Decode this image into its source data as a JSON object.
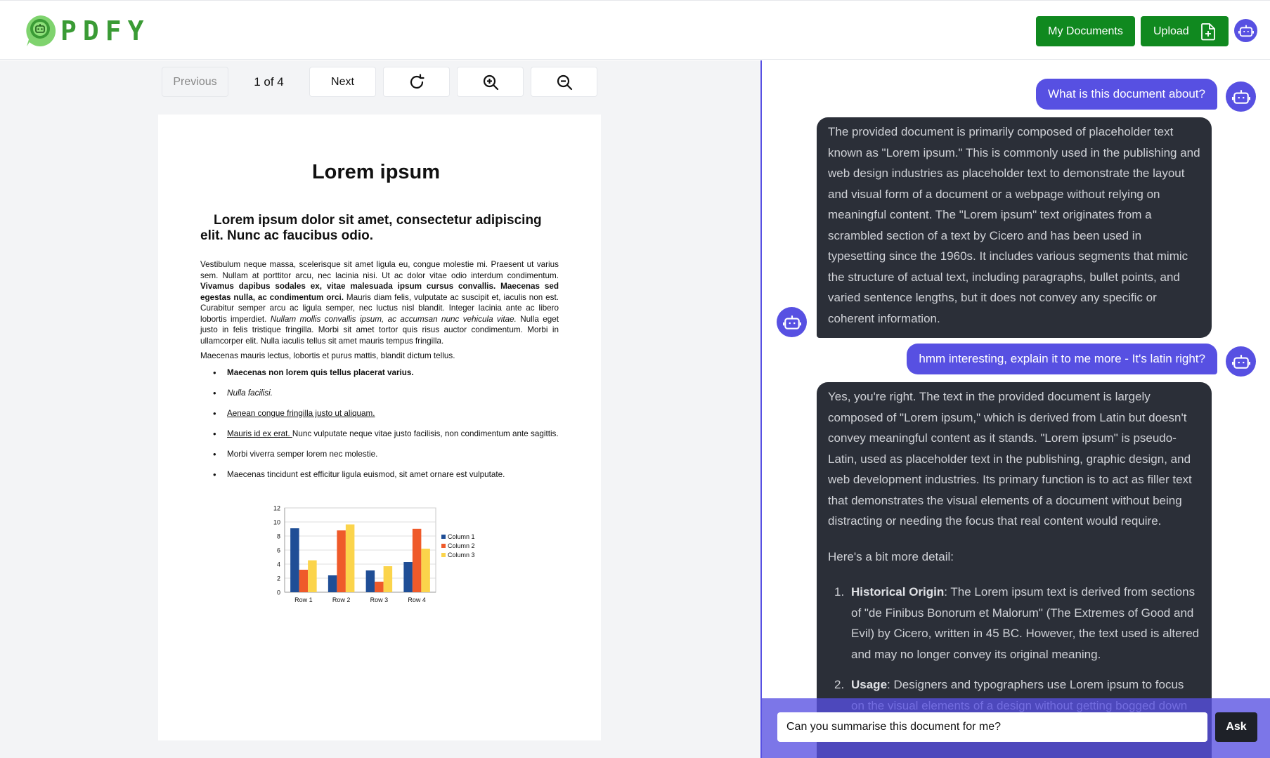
{
  "header": {
    "logo_text": "PDFY",
    "my_documents_label": "My Documents",
    "upload_label": "Upload",
    "icons": {
      "logo": "robot-chat-logo-icon",
      "upload": "file-plus-icon",
      "bot": "robot-icon"
    }
  },
  "toolbar": {
    "previous_label": "Previous",
    "page_indicator": "1 of 4",
    "next_label": "Next",
    "icons": {
      "rotate": "rotate-icon",
      "zoom_in": "zoom-in-icon",
      "zoom_out": "zoom-out-icon"
    }
  },
  "document": {
    "title": "Lorem ipsum",
    "subtitle": "Lorem ipsum dolor sit amet, consectetur adipiscing elit. Nunc ac faucibus odio.",
    "p1": {
      "a": "Vestibulum neque massa, scelerisque sit amet ligula eu, congue molestie mi. Praesent ut varius sem. Nullam at porttitor arcu, nec lacinia nisi. Ut ac dolor vitae odio interdum condimentum. ",
      "b": "Vivamus dapibus sodales ex, vitae malesuada ipsum cursus convallis. Maecenas sed egestas nulla, ac condimentum orci.",
      "c": " Mauris diam felis, vulputate ac suscipit et, iaculis non est. Curabitur semper arcu ac ligula semper, nec luctus nisl blandit. Integer lacinia ante ac libero lobortis imperdiet. ",
      "d": "Nullam mollis convallis ipsum, ac accumsan nunc vehicula vitae.",
      "e": " Nulla eget justo in felis tristique fringilla. Morbi sit amet tortor quis risus auctor condimentum. Morbi in ullamcorper elit. Nulla iaculis tellus sit amet mauris tempus fringilla."
    },
    "p2": "Maecenas mauris lectus, lobortis et purus mattis, blandit dictum tellus.",
    "list": {
      "item1": "Maecenas non lorem quis tellus placerat varius.",
      "item2": "Nulla facilisi.",
      "item3": "Aenean congue fringilla justo ut aliquam. ",
      "item4a": "Mauris id ex erat. ",
      "item4b": "Nunc vulputate neque vitae justo facilisis, non condimentum ante sagittis.",
      "item5": "Morbi viverra semper lorem nec molestie.",
      "item6": "Maecenas tincidunt est efficitur ligula euismod, sit amet ornare est vulputate."
    }
  },
  "chart_data": {
    "type": "bar",
    "categories": [
      "Row 1",
      "Row 2",
      "Row 3",
      "Row 4"
    ],
    "series": [
      {
        "name": "Column 1",
        "values": [
          9.1,
          2.4,
          3.1,
          4.3
        ],
        "color": "#1f4e96"
      },
      {
        "name": "Column 2",
        "values": [
          3.2,
          8.8,
          1.5,
          9.02
        ],
        "color": "#ef5a2a"
      },
      {
        "name": "Column 3",
        "values": [
          4.54,
          9.65,
          3.7,
          6.2
        ],
        "color": "#fbd44b"
      }
    ],
    "ylim": [
      0,
      12
    ],
    "yticks": [
      0,
      2,
      4,
      6,
      8,
      10,
      12
    ],
    "legend": "right",
    "grid": true
  },
  "chat": {
    "user_msg_1": "What is this document about?",
    "assistant_msg_1": "The provided document is primarily composed of placeholder text known as \"Lorem ipsum.\" This is commonly used in the publishing and web design industries as placeholder text to demonstrate the layout and visual form of a document or a webpage without relying on meaningful content. The \"Lorem ipsum\" text originates from a scrambled section of a text by Cicero and has been used in typesetting since the 1960s. It includes various segments that mimic the structure of actual text, including paragraphs, bullet points, and varied sentence lengths, but it does not convey any specific or coherent information.",
    "user_msg_2": "hmm interesting, explain it to me more - It's latin right?",
    "assistant_msg_2": {
      "p1": "Yes, you're right. The text in the provided document is largely composed of \"Lorem ipsum,\" which is derived from Latin but doesn't convey meaningful content as it stands. \"Lorem ipsum\" is pseudo-Latin, used as placeholder text in the publishing, graphic design, and web development industries. Its primary function is to act as filler text that demonstrates the visual elements of a document without being distracting or needing the focus that real content would require.",
      "p2": "Here's a bit more detail:",
      "item1_num": "1.",
      "item1_title": "Historical Origin",
      "item1_text": ": The Lorem ipsum text is derived from sections of \"de Finibus Bonorum et Malorum\" (The Extremes of Good and Evil) by Cicero, written in 45 BC. However, the text used is altered and may no longer convey its original meaning.",
      "item2_num": "2.",
      "item2_title": "Usage",
      "item2_text": ": Designers and typographers use Lorem ipsum to focus on the visual elements of a design without getting bogged down by the specifics of content. It helps clients to"
    },
    "input_value": "Can you summarise this document for me?",
    "ask_label": "Ask"
  },
  "colors": {
    "brand_green": "#10891f",
    "accent_purple": "#5750e2",
    "assistant_bubble": "#2b2f38"
  }
}
